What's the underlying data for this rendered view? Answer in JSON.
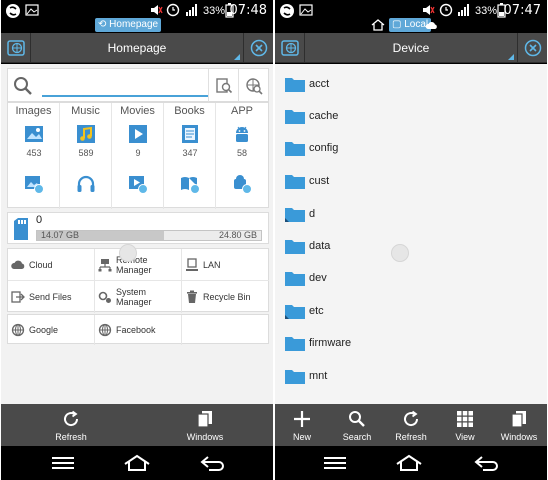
{
  "left_screen": {
    "status": {
      "notification": "Homepage",
      "battery_percent": "33%",
      "time": "07:48"
    },
    "titlebar": {
      "title": "Homepage"
    },
    "search": {
      "placeholder": "",
      "value": ""
    },
    "categories": [
      {
        "label": "Images",
        "count": "453",
        "icon": "image-icon"
      },
      {
        "label": "Music",
        "count": "589",
        "icon": "music-note-icon"
      },
      {
        "label": "Movies",
        "count": "9",
        "icon": "video-icon"
      },
      {
        "label": "Books",
        "count": "347",
        "icon": "book-icon"
      },
      {
        "label": "APP",
        "count": "58",
        "icon": "android-icon"
      }
    ],
    "storage": {
      "label": "0",
      "used": "14.07 GB",
      "total": "24.80 GB",
      "used_fraction": 0.567
    },
    "tools": [
      {
        "label": "Cloud",
        "icon": "cloud-icon"
      },
      {
        "label": "Remote Manager",
        "icon": "remote-manager-icon"
      },
      {
        "label": "LAN",
        "icon": "lan-icon"
      },
      {
        "label": "Send Files",
        "icon": "send-files-icon"
      },
      {
        "label": "System Manager",
        "icon": "system-manager-icon"
      },
      {
        "label": "Recycle Bin",
        "icon": "recycle-bin-icon"
      }
    ],
    "networks": [
      {
        "label": "Google",
        "icon": "globe-icon"
      },
      {
        "label": "Facebook",
        "icon": "globe-icon"
      }
    ],
    "bottombar": {
      "refresh": "Refresh",
      "windows": "Windows"
    }
  },
  "right_screen": {
    "status": {
      "notification": "Local",
      "battery_percent": "33%",
      "time": "07:47"
    },
    "titlebar": {
      "title": "Device"
    },
    "folders": [
      "acct",
      "cache",
      "config",
      "cust",
      "d",
      "data",
      "dev",
      "etc",
      "firmware",
      "mnt"
    ],
    "bottombar": {
      "new": "New",
      "search": "Search",
      "refresh": "Refresh",
      "view": "View",
      "windows": "Windows"
    }
  },
  "colors": {
    "accent": "#48a2d8",
    "folder": "#3a9ad9",
    "toolbar": "#4a4a4a"
  }
}
